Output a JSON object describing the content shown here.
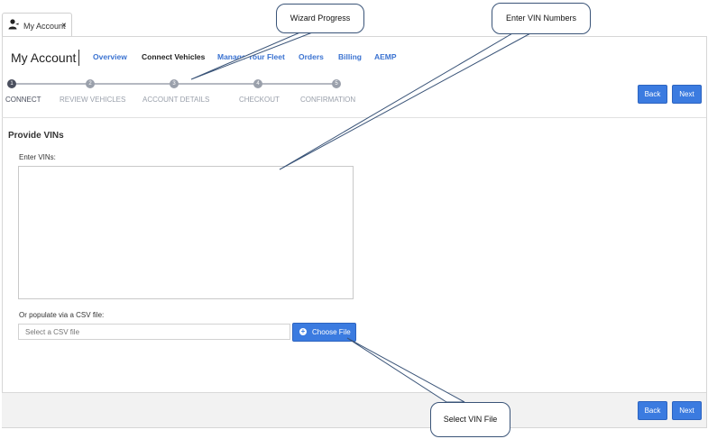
{
  "tab": {
    "label": "My Account",
    "close": "×",
    "icon": "user-icon"
  },
  "header": {
    "title": "My Account"
  },
  "nav": [
    {
      "label": "Overview",
      "active": false
    },
    {
      "label": "Connect Vehicles",
      "active": true
    },
    {
      "label": "Manage Your Fleet",
      "active": false
    },
    {
      "label": "Orders",
      "active": false
    },
    {
      "label": "Billing",
      "active": false
    },
    {
      "label": "AEMP",
      "active": false
    }
  ],
  "wizard": {
    "steps": [
      {
        "num": "1",
        "label": "CONNECT",
        "active": true
      },
      {
        "num": "2",
        "label": "REVIEW VEHICLES",
        "active": false
      },
      {
        "num": "3",
        "label": "ACCOUNT DETAILS",
        "active": false
      },
      {
        "num": "4",
        "label": "CHECKOUT",
        "active": false
      },
      {
        "num": "5",
        "label": "CONFIRMATION",
        "active": false
      }
    ]
  },
  "buttons": {
    "back": "Back",
    "next": "Next"
  },
  "form": {
    "section_title": "Provide VINs",
    "vin_label": "Enter VINs:",
    "vin_value": "",
    "csv_label": "Or populate via a CSV file:",
    "csv_placeholder": "Select a CSV file",
    "choose_file": "Choose File"
  },
  "callouts": {
    "wizard_progress": "Wizard Progress",
    "enter_vin": "Enter VIN Numbers",
    "select_vin_file": "Select VIN File"
  },
  "colors": {
    "accent": "#3b7be0",
    "link": "#3b73d1",
    "callout_border": "#3a5478",
    "footer": "#f2f2f2"
  }
}
